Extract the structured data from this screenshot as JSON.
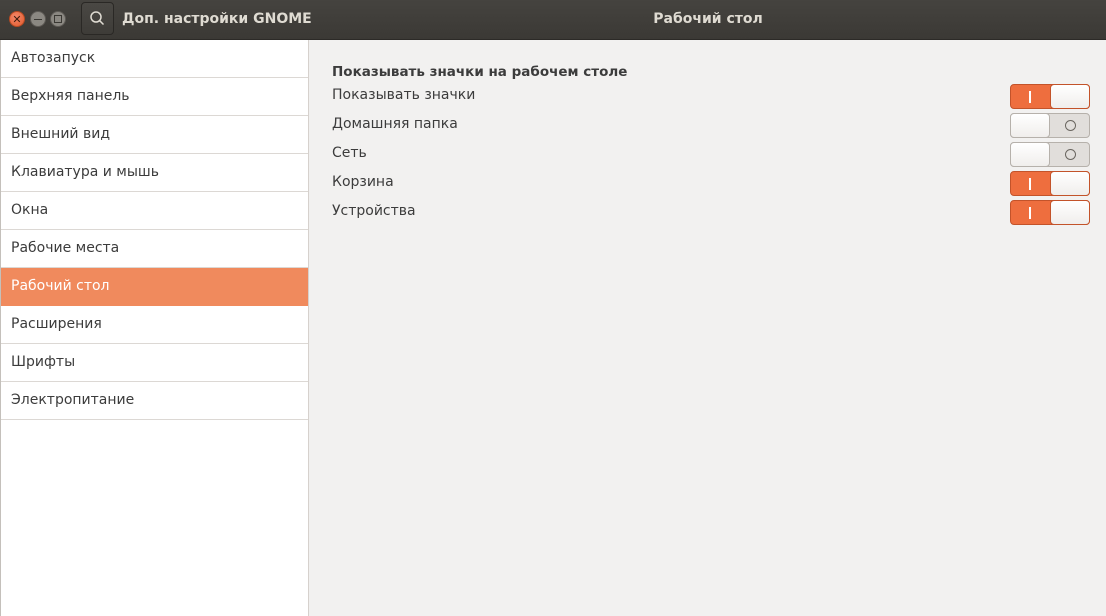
{
  "titlebar": {
    "app_title": "Доп. настройки GNOME",
    "page_title": "Рабочий стол"
  },
  "sidebar": {
    "items": [
      {
        "label": "Автозапуск"
      },
      {
        "label": "Верхняя панель"
      },
      {
        "label": "Внешний вид"
      },
      {
        "label": "Клавиатура и мышь"
      },
      {
        "label": "Окна"
      },
      {
        "label": "Рабочие места"
      },
      {
        "label": "Рабочий стол",
        "selected": true
      },
      {
        "label": "Расширения"
      },
      {
        "label": "Шрифты"
      },
      {
        "label": "Электропитание"
      }
    ]
  },
  "main": {
    "section_title": "Показывать значки на рабочем столе",
    "rows": [
      {
        "label": "Показывать значки",
        "state": "on"
      },
      {
        "label": "Домашняя папка",
        "state": "off"
      },
      {
        "label": "Сеть",
        "state": "off"
      },
      {
        "label": "Корзина",
        "state": "on"
      },
      {
        "label": "Устройства",
        "state": "on"
      }
    ]
  },
  "icons": {
    "close": "close-icon",
    "minimize": "minimize-icon",
    "maximize": "maximize-icon",
    "search": "search-icon"
  },
  "colors": {
    "accent": "#f08a5d",
    "switch_on": "#ee6e3e",
    "titlebar": "#3d3b37"
  }
}
